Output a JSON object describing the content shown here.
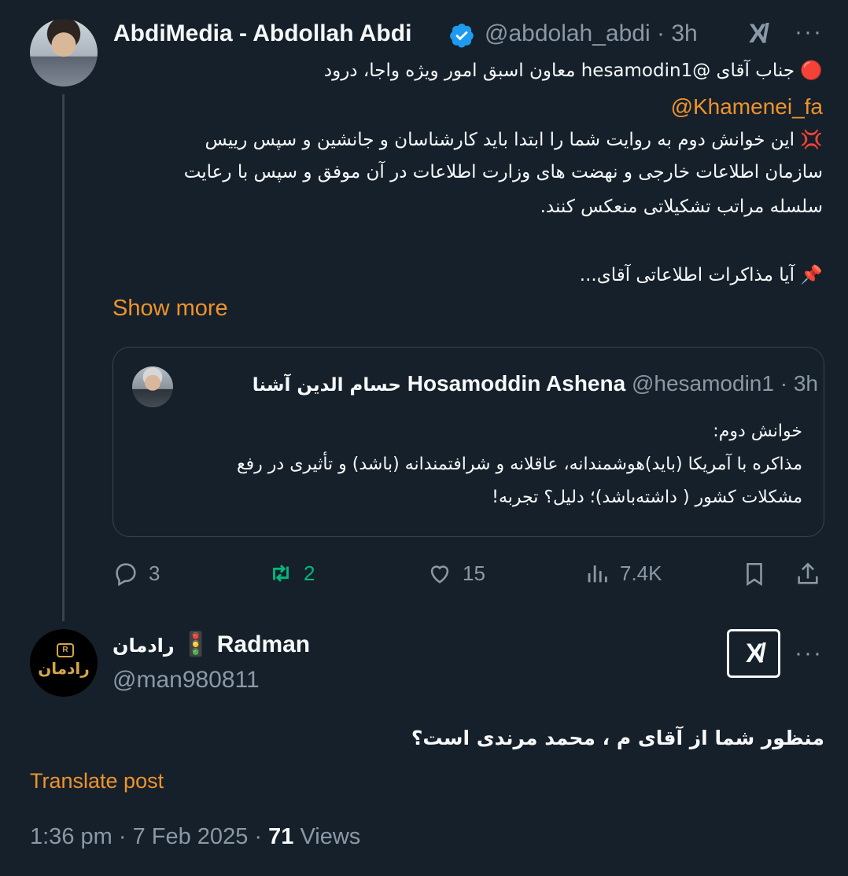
{
  "main_tweet": {
    "author_name": "AbdiMedia - Abdollah Abdi",
    "handle": "@abdolah_abdi",
    "separator": "·",
    "time": "3h",
    "lines": [
      "🔴 جناب آقای @hesamodin1 معاون اسبق امور ویژه واجا، درود",
      "@Khamenei_fa",
      "💢 این خوانش دوم به روایت شما را ابتدا باید کارشناسان و جانشین و سپس رییس",
      "سازمان اطلاعات خارجی و نهضت های وزارت اطلاعات در آن موفق و سپس با رعایت",
      "سلسله مراتب تشکیلاتی منعکس کنند.",
      "📌 آیا مذاکرات اطلاعاتی آقای..."
    ],
    "show_more": "Show more",
    "quoted": {
      "name_fa": "حسام الدین آشنا",
      "name_en": "Hosamoddin Ashena",
      "handle": "@hesamodin1",
      "separator": "·",
      "time": "3h",
      "lines": [
        "خوانش دوم:",
        "مذاکره با آمریکا (باید)هوشمندانه، عاقلانه و شرافتمندانه (باشد) و  تأثیری در رفع",
        "مشکلات کشور ( داشته‌باشد)؛ دلیل؟ تجربه!"
      ]
    },
    "actions": {
      "replies": "3",
      "reposts": "2",
      "likes": "15",
      "views": "7.4K"
    }
  },
  "reply": {
    "author_name": "Radman",
    "author_name_fa": "رادمان",
    "traffic_light": "🚦",
    "handle": "@man980811",
    "avatar_text": "رادمان",
    "text": "منظور شما از آقای م ، محمد مرندی است؟",
    "translate": "Translate post",
    "time": "1:36 pm",
    "separator": "·",
    "date": "7 Feb 2025",
    "views_count": "71",
    "views_label": "Views"
  },
  "colors": {
    "background": "#15202b",
    "text": "#f7f9f9",
    "muted": "#8b98a5",
    "accent": "#f0932b",
    "repost_green": "#00ba7c",
    "verified_blue": "#1d9bf0"
  },
  "icons": [
    "verified-badge-icon",
    "grok-x-icon",
    "more-icon",
    "reply-icon",
    "repost-icon",
    "like-icon",
    "views-icon",
    "bookmark-icon",
    "share-icon"
  ]
}
